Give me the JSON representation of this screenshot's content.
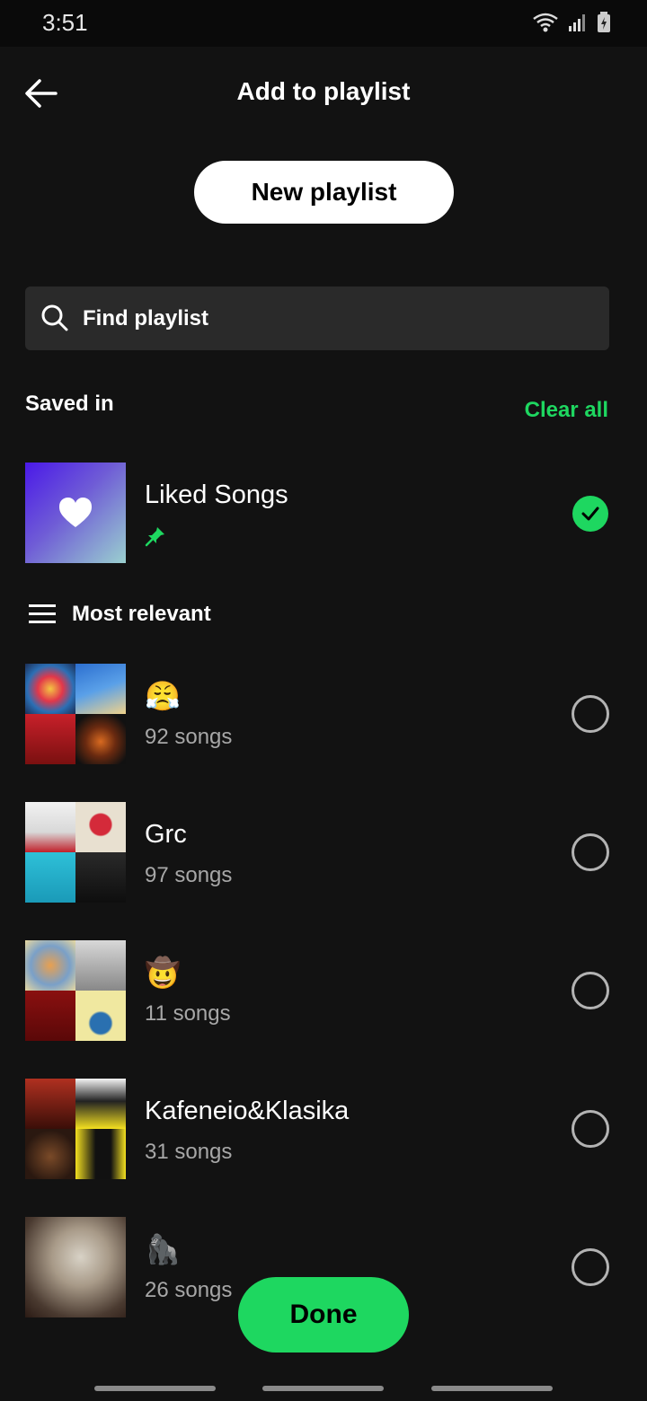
{
  "status_bar": {
    "time": "3:51"
  },
  "header": {
    "title": "Add to playlist"
  },
  "new_playlist_label": "New playlist",
  "search": {
    "label": "Find playlist"
  },
  "saved_in": {
    "title": "Saved in",
    "clear_all": "Clear all"
  },
  "liked": {
    "title": "Liked Songs",
    "checked": true
  },
  "sort": {
    "label": "Most relevant"
  },
  "playlists": [
    {
      "title": "😤",
      "subtitle": "92 songs"
    },
    {
      "title": "Grc",
      "subtitle": "97 songs"
    },
    {
      "title": "🤠",
      "subtitle": "11 songs"
    },
    {
      "title": "Kafeneio&Klasika",
      "subtitle": "31 songs"
    },
    {
      "title": "🦍",
      "subtitle": "26 songs"
    }
  ],
  "done_label": "Done",
  "colors": {
    "accent": "#1ed760",
    "background": "#121212",
    "surface": "#2a2a2a"
  }
}
